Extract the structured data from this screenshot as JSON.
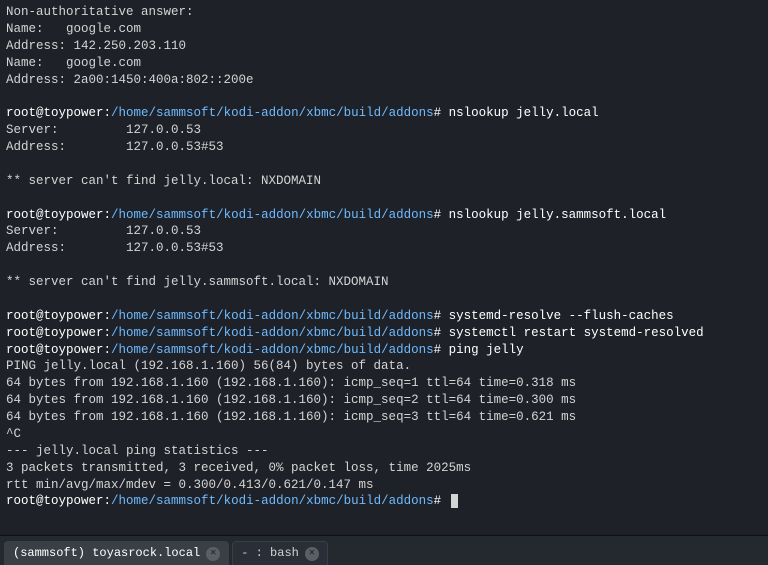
{
  "prompt": {
    "user_host": "root@toypower",
    "sep1": ":",
    "path": "/home/sammsoft/kodi-addon/xbmc/build/addons",
    "sigil": "#"
  },
  "blocks": [
    {
      "type": "out",
      "lines": [
        "Non-authoritative answer:",
        "Name:   google.com",
        "Address: 142.250.203.110",
        "Name:   google.com",
        "Address: 2a00:1450:400a:802::200e",
        ""
      ]
    },
    {
      "type": "prompt",
      "cmd": "nslookup jelly.local"
    },
    {
      "type": "out",
      "lines": [
        "Server:         127.0.0.53",
        "Address:        127.0.0.53#53",
        "",
        "** server can't find jelly.local: NXDOMAIN",
        ""
      ]
    },
    {
      "type": "prompt",
      "cmd": "nslookup jelly.sammsoft.local"
    },
    {
      "type": "out",
      "lines": [
        "Server:         127.0.0.53",
        "Address:        127.0.0.53#53",
        "",
        "** server can't find jelly.sammsoft.local: NXDOMAIN",
        ""
      ]
    },
    {
      "type": "prompt",
      "cmd": "systemd-resolve --flush-caches"
    },
    {
      "type": "prompt",
      "cmd": "systemctl restart systemd-resolved"
    },
    {
      "type": "prompt",
      "cmd": "ping jelly"
    },
    {
      "type": "out",
      "lines": [
        "PING jelly.local (192.168.1.160) 56(84) bytes of data.",
        "64 bytes from 192.168.1.160 (192.168.1.160): icmp_seq=1 ttl=64 time=0.318 ms",
        "64 bytes from 192.168.1.160 (192.168.1.160): icmp_seq=2 ttl=64 time=0.300 ms",
        "64 bytes from 192.168.1.160 (192.168.1.160): icmp_seq=3 ttl=64 time=0.621 ms",
        "^C",
        "--- jelly.local ping statistics ---",
        "3 packets transmitted, 3 received, 0% packet loss, time 2025ms",
        "rtt min/avg/max/mdev = 0.300/0.413/0.621/0.147 ms"
      ]
    },
    {
      "type": "prompt",
      "cmd": "",
      "cursor": true
    }
  ],
  "tabs": [
    {
      "label": "(sammsoft) toyasrock.local",
      "active": true
    },
    {
      "label": "- : bash",
      "active": false
    }
  ]
}
